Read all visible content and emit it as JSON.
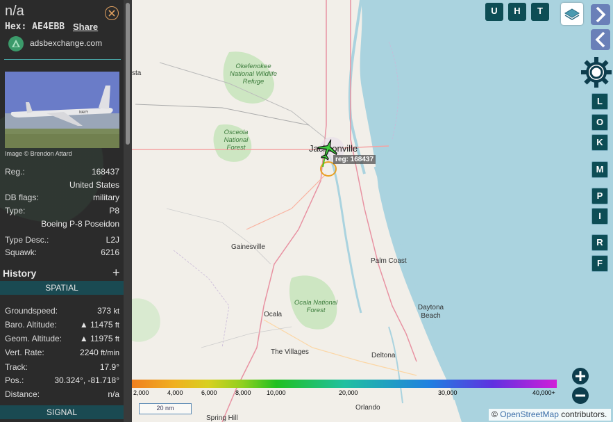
{
  "aircraft": {
    "title": "n/a",
    "hex_label": "Hex:",
    "hex_value": "AE4EBB",
    "share_label": "Share",
    "source": "adsbexchange.com",
    "photo_credit": "Image © Brendon Attard",
    "photo_text": "NAVY"
  },
  "details": [
    {
      "label": "Reg.:",
      "value": "168437"
    },
    {
      "label": "",
      "value": "United States"
    },
    {
      "label": "DB flags:",
      "value": "military"
    },
    {
      "label": "Type:",
      "value": "P8"
    },
    {
      "label": "",
      "value": "Boeing P-8 Poseidon"
    },
    {
      "label": "Type Desc.:",
      "value": "L2J"
    },
    {
      "label": "Squawk:",
      "value": "6216"
    }
  ],
  "history_label": "History",
  "spatial_label": "SPATIAL",
  "signal_label": "SIGNAL",
  "spatial": [
    {
      "label": "Groundspeed:",
      "value": "373",
      "unit": "kt"
    },
    {
      "label": "Baro. Altitude:",
      "value": "▲ 11475",
      "unit": "ft"
    },
    {
      "label": "Geom. Altitude:",
      "value": "▲ 11975",
      "unit": "ft"
    },
    {
      "label": "Vert. Rate:",
      "value": "2240",
      "unit": "ft/min"
    },
    {
      "label": "Track:",
      "value": "17.9°",
      "unit": ""
    },
    {
      "label": "Pos.:",
      "value": "30.324°, -81.718°",
      "unit": ""
    },
    {
      "label": "Distance:",
      "value": "n/a",
      "unit": ""
    }
  ],
  "map": {
    "reg_tag": "reg: 168437",
    "labels": {
      "jacksonville": "Jacksonville",
      "gainesville": "Gainesville",
      "palm_coast": "Palm Coast",
      "daytona": "Daytona Beach",
      "ocala": "Ocala",
      "villages": "The Villages",
      "deltona": "Deltona",
      "orlando": "Orlando",
      "spring_hill": "Spring Hill",
      "sta": "sta",
      "okefenokee": "Okefenokee National Wildlife Refuge",
      "osceola": "Osceola National Forest",
      "ocala_nf": "Ocala National Forest"
    },
    "top_buttons": [
      "U",
      "H",
      "T"
    ],
    "side_buttons": [
      "L",
      "O",
      "K",
      "M",
      "P",
      "I",
      "R",
      "F"
    ],
    "legend_ticks": [
      "2,000",
      "4,000",
      "6,000",
      "8,000",
      "10,000",
      "20,000",
      "30,000",
      "40,000+"
    ],
    "scale_label": "20 nm",
    "attribution_prefix": "©",
    "attribution_link": "OpenStreetMap",
    "attribution_suffix": "contributors."
  }
}
